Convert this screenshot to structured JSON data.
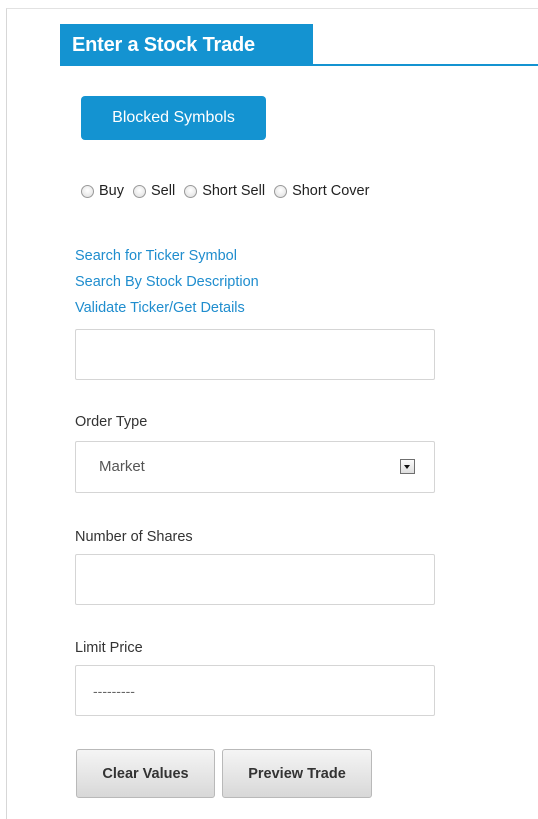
{
  "header": {
    "title": "Enter a Stock Trade"
  },
  "blocked_symbols": {
    "label": "Blocked Symbols"
  },
  "trade_actions": [
    {
      "label": "Buy",
      "selected": false
    },
    {
      "label": "Sell",
      "selected": false
    },
    {
      "label": "Short Sell",
      "selected": false
    },
    {
      "label": "Short Cover",
      "selected": false
    }
  ],
  "links": {
    "search_ticker": "Search for Ticker Symbol",
    "search_description": "Search By Stock Description",
    "validate_ticker": "Validate Ticker/Get Details"
  },
  "ticker": {
    "value": ""
  },
  "order_type": {
    "label": "Order Type",
    "selected": "Market"
  },
  "shares": {
    "label": "Number of Shares",
    "value": ""
  },
  "limit_price": {
    "label": "Limit Price",
    "placeholder": "---------"
  },
  "buttons": {
    "clear": "Clear Values",
    "preview": "Preview Trade"
  },
  "colors": {
    "accent": "#1493d1",
    "link": "#1f8dce"
  },
  "icons": {
    "radio": "radio-button-icon",
    "dropdown": "dropdown-arrow-icon"
  }
}
